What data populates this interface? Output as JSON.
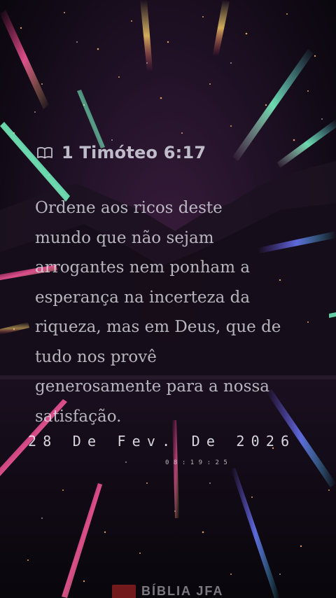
{
  "verse": {
    "reference": "1 Timóteo 6:17",
    "icon": "book-icon",
    "lines": [
      "Ordene aos ricos deste",
      "mundo que não sejam",
      "arrogantes nem ponham a",
      "esperança na incerteza da",
      "riqueza, mas em Deus, que de",
      "tudo nos provê",
      "generosamente para a nossa",
      "satisfação."
    ]
  },
  "date": {
    "text": "28 De Fev. De 2026",
    "time": "08:19:25"
  },
  "watermark": {
    "text": "BÍBLIA JFA",
    "logo_color": "#c92a2a"
  },
  "colors": {
    "background": "#130b18",
    "text": "#dedee6"
  }
}
